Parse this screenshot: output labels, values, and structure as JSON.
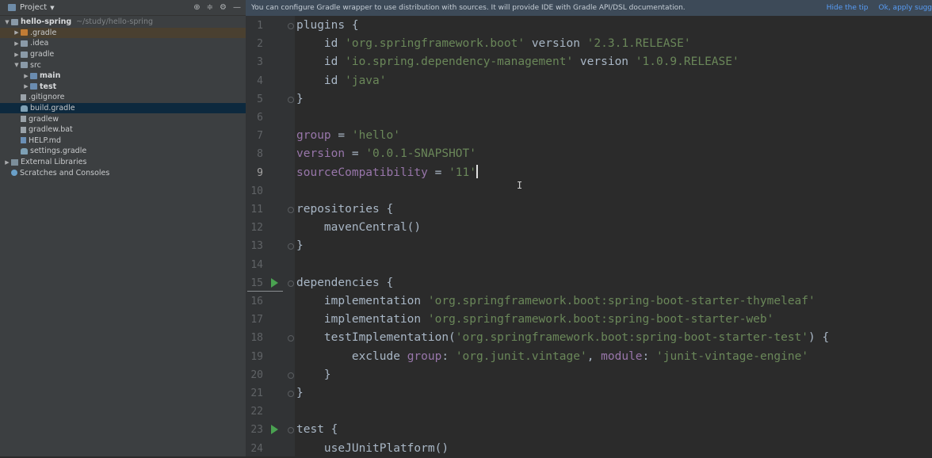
{
  "sidebar": {
    "title": "Project",
    "header_buttons": [
      "target-icon",
      "collapse-icon",
      "gear-icon",
      "minimize-icon"
    ],
    "tree": [
      {
        "label": "hello-spring",
        "hint": "~/study/hello-spring",
        "indent": 0,
        "arrow": "▼",
        "icon": "folder",
        "bold": true
      },
      {
        "label": ".gradle",
        "indent": 1,
        "arrow": "▶",
        "icon": "folder-orange",
        "highlight": true
      },
      {
        "label": ".idea",
        "indent": 1,
        "arrow": "▶",
        "icon": "folder"
      },
      {
        "label": "gradle",
        "indent": 1,
        "arrow": "▶",
        "icon": "folder"
      },
      {
        "label": "src",
        "indent": 1,
        "arrow": "▼",
        "icon": "folder"
      },
      {
        "label": "main",
        "indent": 2,
        "arrow": "▶",
        "icon": "folder-blue",
        "bold": true
      },
      {
        "label": "test",
        "indent": 2,
        "arrow": "▶",
        "icon": "folder-blue",
        "bold": true
      },
      {
        "label": ".gitignore",
        "indent": 1,
        "arrow": "",
        "icon": "file"
      },
      {
        "label": "build.gradle",
        "indent": 1,
        "arrow": "",
        "icon": "elephant",
        "selected": true
      },
      {
        "label": "gradlew",
        "indent": 1,
        "arrow": "",
        "icon": "file"
      },
      {
        "label": "gradlew.bat",
        "indent": 1,
        "arrow": "",
        "icon": "file"
      },
      {
        "label": "HELP.md",
        "indent": 1,
        "arrow": "",
        "icon": "md"
      },
      {
        "label": "settings.gradle",
        "indent": 1,
        "arrow": "",
        "icon": "elephant"
      },
      {
        "label": "External Libraries",
        "indent": 0,
        "arrow": "▶",
        "icon": "lib"
      },
      {
        "label": "Scratches and Consoles",
        "indent": 0,
        "arrow": "",
        "icon": "scratch"
      }
    ]
  },
  "notification": {
    "message": "You can configure Gradle wrapper to use distribution with sources. It will provide IDE with Gradle API/DSL documentation.",
    "hide_tip": "Hide the tip",
    "ok_apply": "Ok, apply sugg"
  },
  "editor": {
    "current_line": 9,
    "lines": [
      {
        "n": "1",
        "fold": true,
        "tokens": [
          {
            "t": "plugins {",
            "c": ""
          }
        ]
      },
      {
        "n": "2",
        "tokens": [
          {
            "t": "    id ",
            "c": ""
          },
          {
            "t": "'org.springframework.boot'",
            "c": "str"
          },
          {
            "t": " version ",
            "c": ""
          },
          {
            "t": "'2.3.1.RELEASE'",
            "c": "str"
          }
        ]
      },
      {
        "n": "3",
        "tokens": [
          {
            "t": "    id ",
            "c": ""
          },
          {
            "t": "'io.spring.dependency-management'",
            "c": "str"
          },
          {
            "t": " version ",
            "c": ""
          },
          {
            "t": "'1.0.9.RELEASE'",
            "c": "str"
          }
        ]
      },
      {
        "n": "4",
        "tokens": [
          {
            "t": "    id ",
            "c": ""
          },
          {
            "t": "'java'",
            "c": "str"
          }
        ]
      },
      {
        "n": "5",
        "fold": true,
        "tokens": [
          {
            "t": "}",
            "c": ""
          }
        ]
      },
      {
        "n": "6",
        "tokens": []
      },
      {
        "n": "7",
        "tokens": [
          {
            "t": "group",
            "c": "prop"
          },
          {
            "t": " = ",
            "c": ""
          },
          {
            "t": "'hello'",
            "c": "str"
          }
        ]
      },
      {
        "n": "8",
        "tokens": [
          {
            "t": "version",
            "c": "prop"
          },
          {
            "t": " = ",
            "c": ""
          },
          {
            "t": "'0.0.1-SNAPSHOT'",
            "c": "str"
          }
        ]
      },
      {
        "n": "9",
        "caret": true,
        "tokens": [
          {
            "t": "sourceCompatibility",
            "c": "prop"
          },
          {
            "t": " = ",
            "c": ""
          },
          {
            "t": "'11'",
            "c": "str"
          }
        ]
      },
      {
        "n": "10",
        "tokens": []
      },
      {
        "n": "11",
        "fold": true,
        "tokens": [
          {
            "t": "repositories {",
            "c": ""
          }
        ]
      },
      {
        "n": "12",
        "tokens": [
          {
            "t": "    mavenCentral()",
            "c": ""
          }
        ]
      },
      {
        "n": "13",
        "fold": true,
        "tokens": [
          {
            "t": "}",
            "c": ""
          }
        ]
      },
      {
        "n": "14",
        "tokens": []
      },
      {
        "n": "15",
        "run": true,
        "fold": true,
        "tokens": [
          {
            "t": "dependencies {",
            "c": ""
          }
        ]
      },
      {
        "n": "16",
        "tokens": [
          {
            "t": "    implementation ",
            "c": ""
          },
          {
            "t": "'org.springframework.boot:spring-boot-starter-thymeleaf'",
            "c": "str"
          }
        ]
      },
      {
        "n": "17",
        "tokens": [
          {
            "t": "    implementation ",
            "c": ""
          },
          {
            "t": "'org.springframework.boot:spring-boot-starter-web'",
            "c": "str"
          }
        ]
      },
      {
        "n": "18",
        "fold": true,
        "tokens": [
          {
            "t": "    testImplementation(",
            "c": ""
          },
          {
            "t": "'org.springframework.boot:spring-boot-starter-test'",
            "c": "str"
          },
          {
            "t": ") {",
            "c": ""
          }
        ]
      },
      {
        "n": "19",
        "tokens": [
          {
            "t": "        exclude ",
            "c": ""
          },
          {
            "t": "group",
            "c": "prop"
          },
          {
            "t": ": ",
            "c": ""
          },
          {
            "t": "'org.junit.vintage'",
            "c": "str"
          },
          {
            "t": ", ",
            "c": ""
          },
          {
            "t": "module",
            "c": "prop"
          },
          {
            "t": ": ",
            "c": ""
          },
          {
            "t": "'junit-vintage-engine'",
            "c": "str"
          }
        ]
      },
      {
        "n": "20",
        "fold": true,
        "tokens": [
          {
            "t": "    }",
            "c": ""
          }
        ]
      },
      {
        "n": "21",
        "fold": true,
        "tokens": [
          {
            "t": "}",
            "c": ""
          }
        ]
      },
      {
        "n": "22",
        "tokens": []
      },
      {
        "n": "23",
        "run": true,
        "fold": true,
        "tokens": [
          {
            "t": "test {",
            "c": ""
          }
        ]
      },
      {
        "n": "24",
        "tokens": [
          {
            "t": "    useJUnitPlatform()",
            "c": ""
          }
        ]
      }
    ]
  },
  "colors": {
    "editor_bg": "#2b2b2b",
    "sidebar_bg": "#3c3f41",
    "string": "#6a8759",
    "property": "#9876aa",
    "run_icon": "#4aa251",
    "link": "#589df6"
  }
}
